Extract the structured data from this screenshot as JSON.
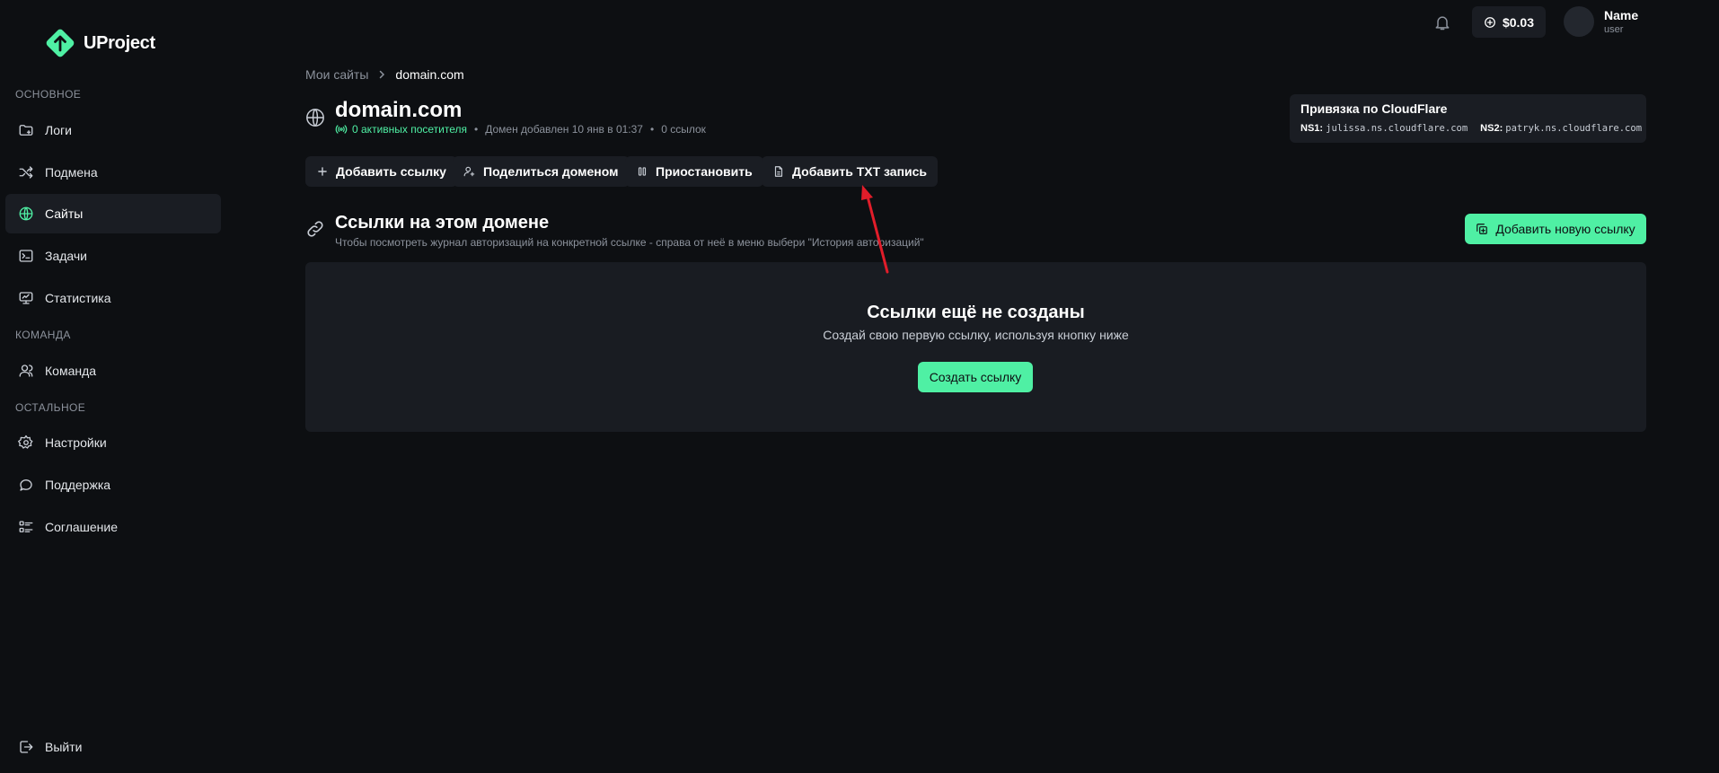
{
  "brand": {
    "name": "UProject",
    "accent": "#4ff0a4",
    "background": "#0d0f12",
    "surface": "#1a1d23"
  },
  "sidebar": {
    "sections": [
      {
        "label": "ОСНОВНОЕ"
      },
      {
        "label": "КОМАНДА"
      },
      {
        "label": "ОСТАЛЬНОЕ"
      }
    ],
    "items": [
      {
        "label": "Логи",
        "icon": "folder-icon"
      },
      {
        "label": "Подмена",
        "icon": "shuffle-icon"
      },
      {
        "label": "Сайты",
        "icon": "globe-icon",
        "active": true
      },
      {
        "label": "Задачи",
        "icon": "terminal-icon"
      },
      {
        "label": "Статистика",
        "icon": "monitor-icon"
      },
      {
        "label": "Команда",
        "icon": "users-icon"
      },
      {
        "label": "Настройки",
        "icon": "gear-icon"
      },
      {
        "label": "Поддержка",
        "icon": "chat-icon"
      },
      {
        "label": "Соглашение",
        "icon": "list-icon"
      }
    ],
    "logout": {
      "label": "Выйти",
      "icon": "logout-icon"
    }
  },
  "topbar": {
    "balance": "$0.03",
    "user": {
      "name": "Name",
      "role": "user"
    }
  },
  "breadcrumb": {
    "parent": "Мои сайты",
    "current": "domain.com"
  },
  "domain": {
    "title": "domain.com",
    "active_visitors": "0 активных посетителя",
    "added": "Домен добавлен 10 янв в 01:37",
    "links_count": "0 ссылок"
  },
  "cloudflare": {
    "title": "Привязка по CloudFlare",
    "ns1_label": "NS1:",
    "ns1": "julissa.ns.cloudflare.com",
    "ns2_label": "NS2:",
    "ns2": "patryk.ns.cloudflare.com"
  },
  "actions": {
    "add_link": "Добавить ссылку",
    "share_domain": "Поделиться доменом",
    "pause": "Приостановить",
    "add_txt": "Добавить TXT запись"
  },
  "links_section": {
    "title": "Ссылки на этом домене",
    "subtitle": "Чтобы посмотреть журнал авторизаций на конкретной ссылке - справа от неё в меню выбери \"История авторизаций\"",
    "new_link_button": "Добавить новую ссылку"
  },
  "empty_state": {
    "title": "Ссылки ещё не созданы",
    "subtitle": "Создай свою первую ссылку, используя кнопку ниже",
    "button": "Создать ссылку"
  }
}
